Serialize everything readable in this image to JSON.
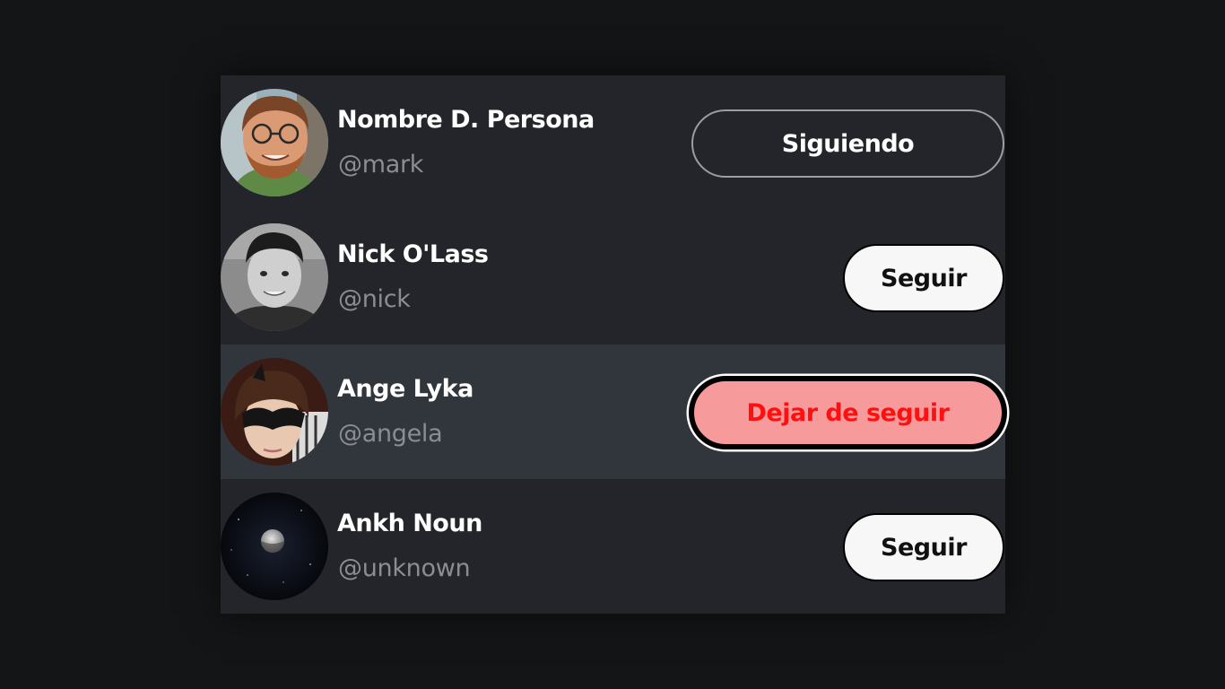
{
  "users": [
    {
      "name": "Nombre D. Persona",
      "handle": "@mark",
      "button": "Siguiendo",
      "state": "following"
    },
    {
      "name": "Nick O'Lass",
      "handle": "@nick",
      "button": "Seguir",
      "state": "not-following"
    },
    {
      "name": "Ange Lyka",
      "handle": "@angela",
      "button": "Dejar de seguir",
      "state": "unfollow-hover"
    },
    {
      "name": "Ankh Noun",
      "handle": "@unknown",
      "button": "Seguir",
      "state": "not-following"
    }
  ],
  "colors": {
    "background": "#141516",
    "card": "#23252a",
    "row_hover": "#31353c",
    "unfollow_bg": "#f69a9c",
    "unfollow_text": "#ff1010",
    "handle_text": "#8a8d93"
  }
}
